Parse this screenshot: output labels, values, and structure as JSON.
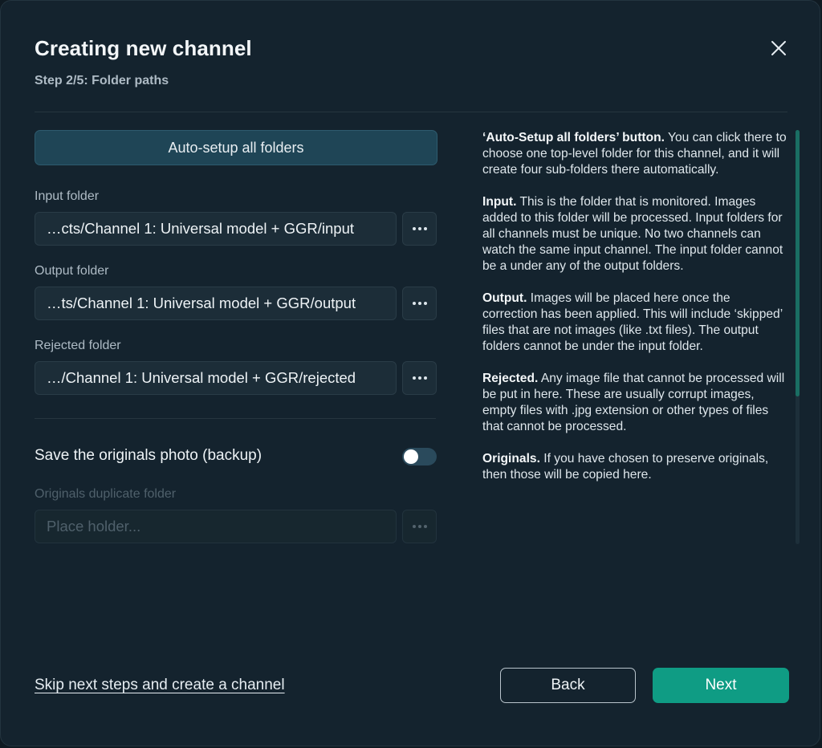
{
  "dialog": {
    "title": "Creating new channel",
    "subtitle": "Step 2/5: Folder paths",
    "close_icon": "close-icon"
  },
  "auto_setup": {
    "label": "Auto-setup all folders"
  },
  "fields": {
    "input": {
      "label": "Input folder",
      "value": "…cts/Channel 1: Universal model + GGR/input"
    },
    "output": {
      "label": "Output folder",
      "value": "…ts/Channel 1: Universal model + GGR/output"
    },
    "rejected": {
      "label": "Rejected folder",
      "value": "…/Channel 1: Universal model + GGR/rejected"
    },
    "originals": {
      "label": "Originals duplicate folder",
      "value": "",
      "placeholder": "Place holder..."
    }
  },
  "backup": {
    "label": "Save the originals photo (backup)",
    "enabled": false
  },
  "help": {
    "auto_title": "‘Auto-Setup all folders’ button.",
    "auto_text": " You can click there to choose one top-level folder for this channel, and it will create four sub-folders there automatically.",
    "input_title": "Input.",
    "input_text": " This is the folder that is monitored. Images added to this folder will be processed. Input folders for all channels must be unique. No two channels can watch the same input channel. The input folder cannot be a under any of the output folders.",
    "output_title": "Output.",
    "output_text": " Images will be placed here once the correction has been applied. This will include ‘skipped’ files that are not images (like .txt files). The output folders cannot be under the input folder.",
    "rejected_title": "Rejected.",
    "rejected_text": " Any image file that cannot be processed will be put in here.  These are usually corrupt images, empty files with .jpg extension or other types of files that cannot be processed.",
    "originals_title": "Originals.",
    "originals_text": " If you have chosen to preserve originals, then those will be copied here."
  },
  "footer": {
    "skip_label": "Skip next steps and create a channel",
    "back_label": "Back",
    "next_label": "Next"
  },
  "colors": {
    "background": "#14232e",
    "accent": "#0f9c84",
    "auto_button": "#1f4556"
  }
}
